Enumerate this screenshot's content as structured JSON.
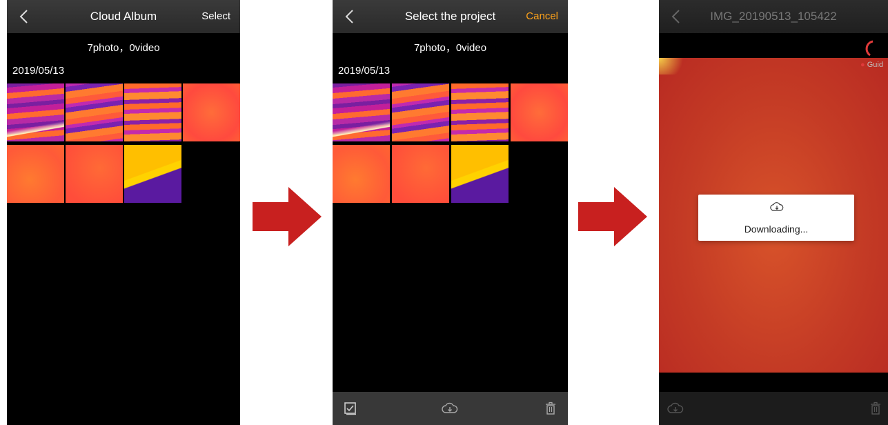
{
  "colors": {
    "accent_orange": "#ffa31a",
    "arrow_red": "#c8201f",
    "bar_bg": "#2f2f2f"
  },
  "screen1": {
    "back_icon": "chevron-left-icon",
    "title": "Cloud Album",
    "action": "Select",
    "counts": "7photo，0video",
    "date": "2019/05/13"
  },
  "screen2": {
    "back_icon": "chevron-left-icon",
    "title": "Select the project",
    "action": "Cancel",
    "counts": "7photo，0video",
    "date": "2019/05/13",
    "toolbar_icons": [
      "checkbox-icon",
      "cloud-download-icon",
      "trash-icon"
    ]
  },
  "screen3": {
    "back_icon": "chevron-left-icon",
    "title": "IMG_20190513_105422",
    "watermark": "Guid",
    "dialog_text": "Downloading...",
    "dialog_icon": "cloud-download-icon",
    "toolbar_icons": [
      "cloud-download-icon",
      "trash-icon"
    ]
  },
  "flow_arrows": [
    "arrow-right-icon",
    "arrow-right-icon"
  ]
}
